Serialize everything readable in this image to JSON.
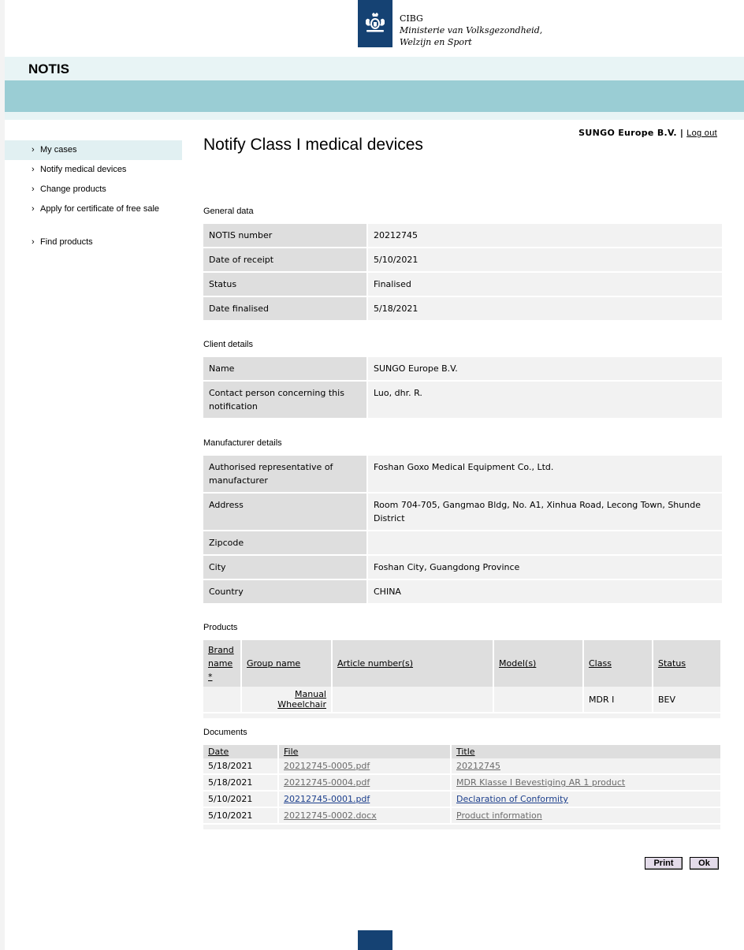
{
  "header": {
    "org_line1": "CIBG",
    "org_line2": "Ministerie van Volksgezondheid,",
    "org_line3": "Welzijn en Sport",
    "app_name": "NOTIS",
    "brand_color": "#154273",
    "band_color": "#9acdd4"
  },
  "user": {
    "company": "SUNGO Europe B.V.",
    "separator": "|",
    "logout": "Log out"
  },
  "nav": {
    "items": [
      {
        "label": "My cases"
      },
      {
        "label": "Notify medical devices"
      },
      {
        "label": "Change products"
      },
      {
        "label": "Apply for certificate of free sale"
      },
      {
        "label": "Find products"
      }
    ],
    "chevron": "›"
  },
  "page": {
    "title": "Notify Class I medical devices"
  },
  "general": {
    "title": "General data",
    "rows": [
      {
        "key": "NOTIS number",
        "value": "20212745"
      },
      {
        "key": "Date of receipt",
        "value": "5/10/2021"
      },
      {
        "key": "Status",
        "value": "Finalised"
      },
      {
        "key": "Date finalised",
        "value": "5/18/2021"
      }
    ]
  },
  "client": {
    "title": "Client details",
    "rows": [
      {
        "key": "Name",
        "value": "SUNGO Europe B.V."
      },
      {
        "key": "Contact person concerning this notification",
        "value": "Luo, dhr. R."
      }
    ]
  },
  "manufacturer": {
    "title": "Manufacturer details",
    "rows": [
      {
        "key": "Authorised representative of manufacturer",
        "value": "Foshan Goxo Medical Equipment Co., Ltd."
      },
      {
        "key": "Address",
        "value": "Room 704-705, Gangmao Bldg, No. A1, Xinhua Road, Lecong Town, Shunde District"
      },
      {
        "key": "Zipcode",
        "value": ""
      },
      {
        "key": "City",
        "value": "Foshan City, Guangdong Province"
      },
      {
        "key": "Country",
        "value": "CHINA"
      }
    ]
  },
  "products": {
    "title": "Products",
    "headers": [
      "Brand name *",
      "Group name",
      "Article number(s)",
      "Model(s)",
      "Class",
      "Status"
    ],
    "rows": [
      {
        "brand": "",
        "group": "Manual Wheelchair",
        "article": "",
        "model": "",
        "class": "MDR I",
        "status": "BEV"
      }
    ]
  },
  "documents": {
    "title": "Documents",
    "headers": [
      "Date",
      "File",
      "Title"
    ],
    "rows": [
      {
        "date": "5/18/2021",
        "file": "20212745-0005.pdf",
        "title": "20212745"
      },
      {
        "date": "5/18/2021",
        "file": "20212745-0004.pdf",
        "title": "MDR Klasse I Bevestiging AR 1 product"
      },
      {
        "date": "5/10/2021",
        "file": "20212745-0001.pdf",
        "title": "Declaration of Conformity"
      },
      {
        "date": "5/10/2021",
        "file": "20212745-0002.docx",
        "title": "Product information"
      }
    ]
  },
  "buttons": {
    "print": "Print",
    "ok": "Ok"
  }
}
